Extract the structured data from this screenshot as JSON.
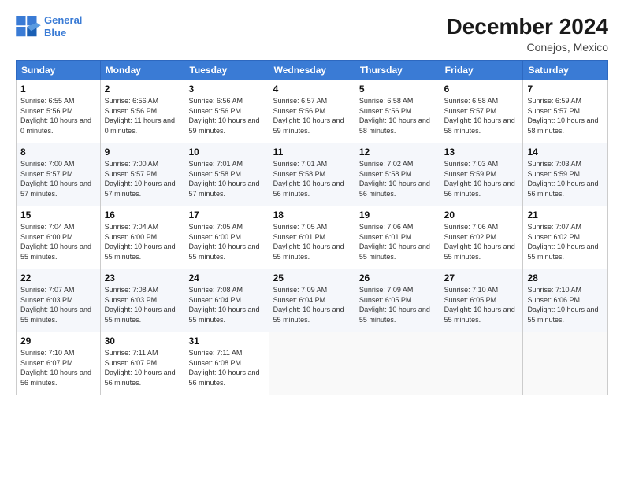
{
  "logo": {
    "line1": "General",
    "line2": "Blue"
  },
  "title": "December 2024",
  "location": "Conejos, Mexico",
  "days_of_week": [
    "Sunday",
    "Monday",
    "Tuesday",
    "Wednesday",
    "Thursday",
    "Friday",
    "Saturday"
  ],
  "weeks": [
    [
      {
        "day": 1,
        "sunrise": "6:55 AM",
        "sunset": "5:56 PM",
        "daylight": "10 hours and 0 minutes"
      },
      {
        "day": 2,
        "sunrise": "6:56 AM",
        "sunset": "5:56 PM",
        "daylight": "11 hours and 0 minutes"
      },
      {
        "day": 3,
        "sunrise": "6:56 AM",
        "sunset": "5:56 PM",
        "daylight": "10 hours and 59 minutes"
      },
      {
        "day": 4,
        "sunrise": "6:57 AM",
        "sunset": "5:56 PM",
        "daylight": "10 hours and 59 minutes"
      },
      {
        "day": 5,
        "sunrise": "6:58 AM",
        "sunset": "5:56 PM",
        "daylight": "10 hours and 58 minutes"
      },
      {
        "day": 6,
        "sunrise": "6:58 AM",
        "sunset": "5:57 PM",
        "daylight": "10 hours and 58 minutes"
      },
      {
        "day": 7,
        "sunrise": "6:59 AM",
        "sunset": "5:57 PM",
        "daylight": "10 hours and 58 minutes"
      }
    ],
    [
      {
        "day": 8,
        "sunrise": "7:00 AM",
        "sunset": "5:57 PM",
        "daylight": "10 hours and 57 minutes"
      },
      {
        "day": 9,
        "sunrise": "7:00 AM",
        "sunset": "5:57 PM",
        "daylight": "10 hours and 57 minutes"
      },
      {
        "day": 10,
        "sunrise": "7:01 AM",
        "sunset": "5:58 PM",
        "daylight": "10 hours and 57 minutes"
      },
      {
        "day": 11,
        "sunrise": "7:01 AM",
        "sunset": "5:58 PM",
        "daylight": "10 hours and 56 minutes"
      },
      {
        "day": 12,
        "sunrise": "7:02 AM",
        "sunset": "5:58 PM",
        "daylight": "10 hours and 56 minutes"
      },
      {
        "day": 13,
        "sunrise": "7:03 AM",
        "sunset": "5:59 PM",
        "daylight": "10 hours and 56 minutes"
      },
      {
        "day": 14,
        "sunrise": "7:03 AM",
        "sunset": "5:59 PM",
        "daylight": "10 hours and 56 minutes"
      }
    ],
    [
      {
        "day": 15,
        "sunrise": "7:04 AM",
        "sunset": "6:00 PM",
        "daylight": "10 hours and 55 minutes"
      },
      {
        "day": 16,
        "sunrise": "7:04 AM",
        "sunset": "6:00 PM",
        "daylight": "10 hours and 55 minutes"
      },
      {
        "day": 17,
        "sunrise": "7:05 AM",
        "sunset": "6:00 PM",
        "daylight": "10 hours and 55 minutes"
      },
      {
        "day": 18,
        "sunrise": "7:05 AM",
        "sunset": "6:01 PM",
        "daylight": "10 hours and 55 minutes"
      },
      {
        "day": 19,
        "sunrise": "7:06 AM",
        "sunset": "6:01 PM",
        "daylight": "10 hours and 55 minutes"
      },
      {
        "day": 20,
        "sunrise": "7:06 AM",
        "sunset": "6:02 PM",
        "daylight": "10 hours and 55 minutes"
      },
      {
        "day": 21,
        "sunrise": "7:07 AM",
        "sunset": "6:02 PM",
        "daylight": "10 hours and 55 minutes"
      }
    ],
    [
      {
        "day": 22,
        "sunrise": "7:07 AM",
        "sunset": "6:03 PM",
        "daylight": "10 hours and 55 minutes"
      },
      {
        "day": 23,
        "sunrise": "7:08 AM",
        "sunset": "6:03 PM",
        "daylight": "10 hours and 55 minutes"
      },
      {
        "day": 24,
        "sunrise": "7:08 AM",
        "sunset": "6:04 PM",
        "daylight": "10 hours and 55 minutes"
      },
      {
        "day": 25,
        "sunrise": "7:09 AM",
        "sunset": "6:04 PM",
        "daylight": "10 hours and 55 minutes"
      },
      {
        "day": 26,
        "sunrise": "7:09 AM",
        "sunset": "6:05 PM",
        "daylight": "10 hours and 55 minutes"
      },
      {
        "day": 27,
        "sunrise": "7:10 AM",
        "sunset": "6:05 PM",
        "daylight": "10 hours and 55 minutes"
      },
      {
        "day": 28,
        "sunrise": "7:10 AM",
        "sunset": "6:06 PM",
        "daylight": "10 hours and 55 minutes"
      }
    ],
    [
      {
        "day": 29,
        "sunrise": "7:10 AM",
        "sunset": "6:07 PM",
        "daylight": "10 hours and 56 minutes"
      },
      {
        "day": 30,
        "sunrise": "7:11 AM",
        "sunset": "6:07 PM",
        "daylight": "10 hours and 56 minutes"
      },
      {
        "day": 31,
        "sunrise": "7:11 AM",
        "sunset": "6:08 PM",
        "daylight": "10 hours and 56 minutes"
      },
      null,
      null,
      null,
      null
    ]
  ],
  "labels": {
    "sunrise": "Sunrise:",
    "sunset": "Sunset:",
    "daylight": "Daylight:"
  }
}
